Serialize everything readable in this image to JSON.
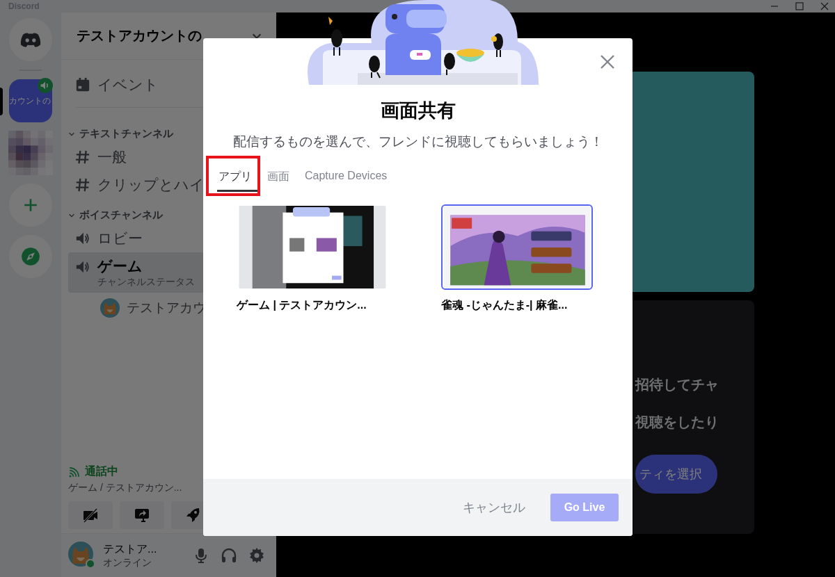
{
  "window": {
    "title": "Discord"
  },
  "servers": [
    {
      "kind": "home",
      "selected": false
    },
    {
      "kind": "server",
      "label": "カウントの",
      "selected": true,
      "voice_active": true
    },
    {
      "kind": "picture",
      "selected": false
    },
    {
      "kind": "add",
      "selected": false
    },
    {
      "kind": "explore",
      "selected": false
    }
  ],
  "channel_sidebar": {
    "server_name": "テストアカウントの",
    "items": [
      {
        "kind": "event",
        "label": "イベント"
      },
      {
        "kind": "category",
        "label": "テキストチャンネル",
        "expanded": true,
        "children": [
          {
            "kind": "text",
            "label": "一般",
            "selected": false
          },
          {
            "kind": "text",
            "label": "クリップとハイ",
            "selected": false
          }
        ]
      },
      {
        "kind": "category",
        "label": "ボイスチャンネル",
        "expanded": true,
        "children": [
          {
            "kind": "voice",
            "label": "ロビー",
            "selected": false
          },
          {
            "kind": "voice",
            "label": "ゲーム",
            "status": "チャンネルステータス",
            "selected": true,
            "children": [
              {
                "kind": "member",
                "label": "テストアカウ"
              }
            ]
          }
        ]
      }
    ]
  },
  "voice_panel": {
    "status": "通話中",
    "channel": "ゲーム / テストアカウン...",
    "buttons": [
      {
        "kind": "camera_off"
      },
      {
        "kind": "screen_share"
      },
      {
        "kind": "activity"
      }
    ]
  },
  "user_panel": {
    "name": "テストア...",
    "status": "オンライン",
    "controls": [
      {
        "kind": "mic"
      },
      {
        "kind": "headphones"
      },
      {
        "kind": "settings"
      }
    ]
  },
  "main": {
    "text_lines": [
      "招待してチャ",
      "視聴をしたり"
    ],
    "button": "ティを選択"
  },
  "modal": {
    "title": "画面共有",
    "subtitle": "配信するものを選んで、フレンドに視聴してもらいましょう！",
    "tabs": [
      {
        "label": "アプリ",
        "selected": true,
        "annotated": true
      },
      {
        "label": "画面",
        "selected": false,
        "annotated": false
      },
      {
        "label": "Capture Devices",
        "selected": false,
        "annotated": false
      }
    ],
    "sources": [
      {
        "label": "ゲーム | テストアカウン...",
        "selected": false,
        "kind": "picture"
      },
      {
        "label": "雀魂 -じゃんたま-| 麻雀...",
        "selected": true,
        "kind": "picture"
      }
    ],
    "cancel": "キャンセル",
    "confirm": {
      "label": "Go Live",
      "disabled": true
    }
  }
}
